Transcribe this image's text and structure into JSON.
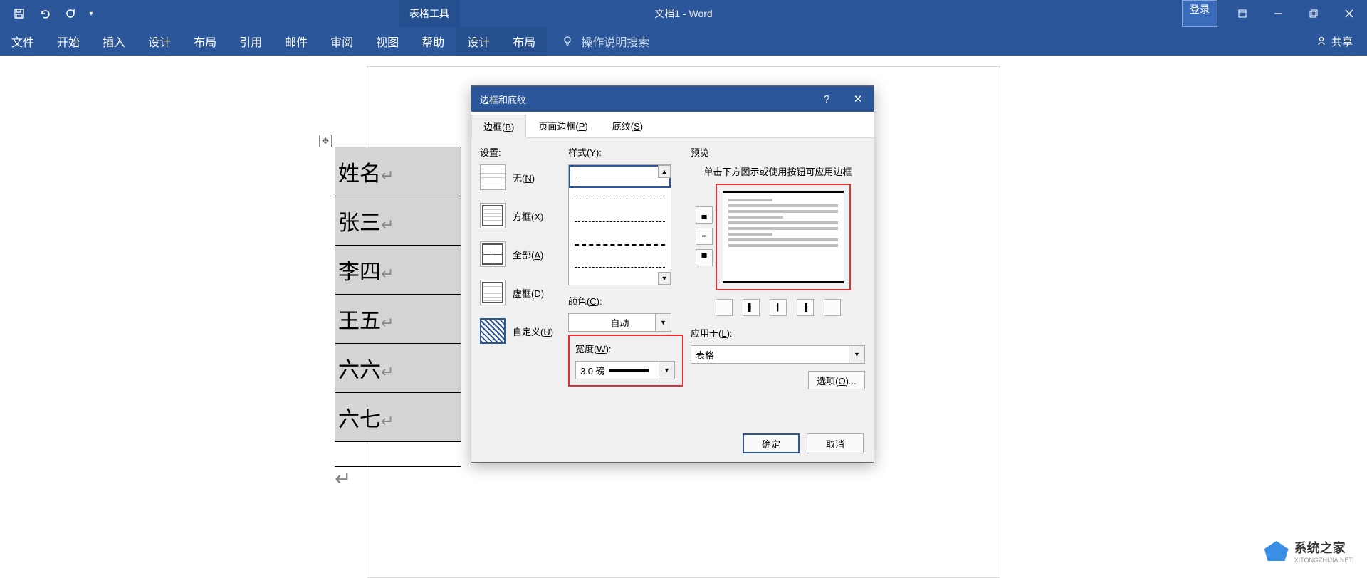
{
  "titlebar": {
    "tools_context": "表格工具",
    "doc_title": "文档1 - Word",
    "login": "登录"
  },
  "ribbon": {
    "tabs": [
      "文件",
      "开始",
      "插入",
      "设计",
      "布局",
      "引用",
      "邮件",
      "审阅",
      "视图",
      "帮助"
    ],
    "ctx_tabs": [
      "设计",
      "布局"
    ],
    "tell_me": "操作说明搜索",
    "share": "共享"
  },
  "table_rows": [
    "姓名",
    "张三",
    "李四",
    "王五",
    "六六",
    "六七"
  ],
  "dialog": {
    "title": "边框和底纹",
    "tabs": {
      "borders": "边框(B)",
      "page_borders": "页面边框(P)",
      "shading": "底纹(S)"
    },
    "settings_label": "设置:",
    "setting_items": {
      "none": "无(N)",
      "box": "方框(X)",
      "all": "全部(A)",
      "grid": "虚框(D)",
      "custom": "自定义(U)"
    },
    "style_label": "样式(Y):",
    "color_label": "颜色(C):",
    "color_value": "自动",
    "width_label": "宽度(W):",
    "width_value": "3.0 磅",
    "preview_label": "预览",
    "preview_hint": "单击下方图示或使用按钮可应用边框",
    "apply_label": "应用于(L):",
    "apply_value": "表格",
    "options_btn": "选项(O)...",
    "ok": "确定",
    "cancel": "取消"
  },
  "watermark": {
    "brand": "系统之家",
    "url": "XITONGZHIJIA.NET"
  }
}
